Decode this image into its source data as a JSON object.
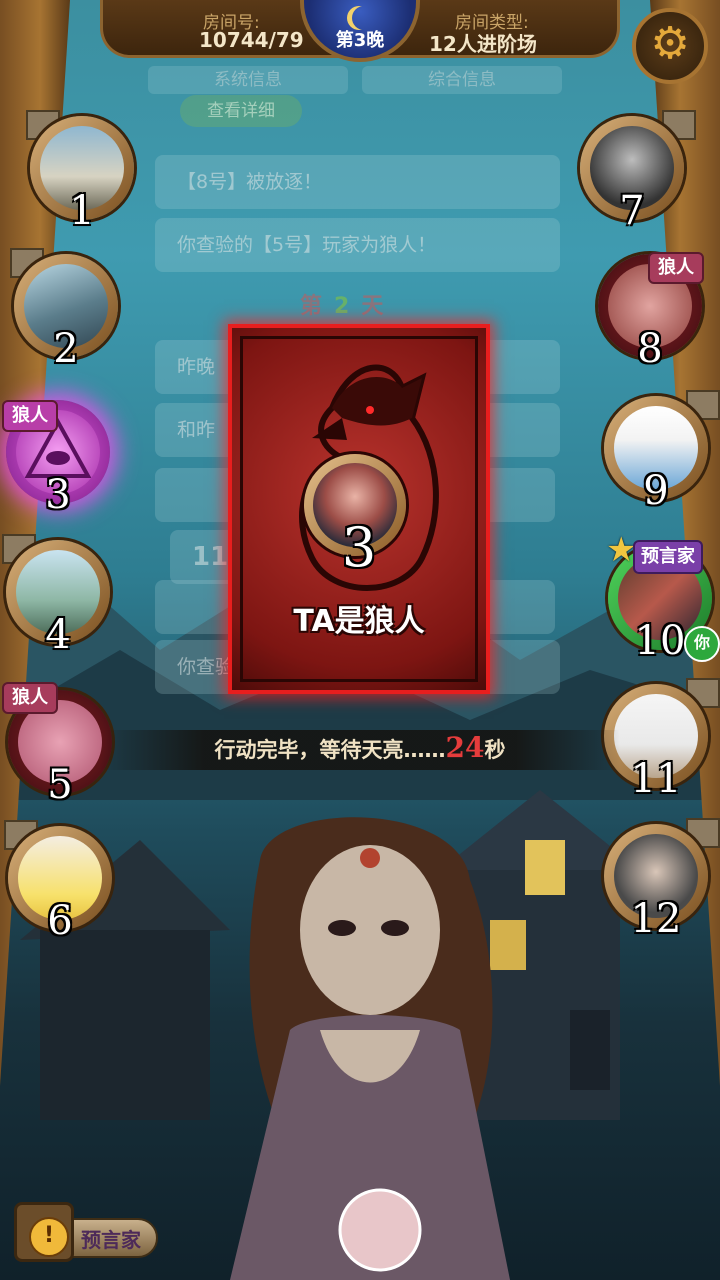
{
  "room": {
    "id_label": "房间号:",
    "id_value": "10744/79",
    "type_label": "房间类型:",
    "type_value": "12人进阶场",
    "night": "第3晚"
  },
  "settings": {
    "icon": "gear-icon"
  },
  "background_log": {
    "tab_left": "系统信息",
    "tab_right": "综合信息",
    "detail_button": "查看详细",
    "msg_exiled": "【8号】被放逐！",
    "msg_check": "你查验的【5号】玩家为狼人！",
    "day_prefix": "第",
    "day_num": "2",
    "day_suffix": "天",
    "msg_last_night": "昨晚",
    "msg_and": "和昨",
    "msg_count": "11",
    "msg_check2": "你查验"
  },
  "players": [
    {
      "num": "1"
    },
    {
      "num": "2"
    },
    {
      "num": "3",
      "tag": "狼人"
    },
    {
      "num": "4"
    },
    {
      "num": "5",
      "tag": "狼人"
    },
    {
      "num": "6"
    },
    {
      "num": "7"
    },
    {
      "num": "8",
      "tag": "狼人"
    },
    {
      "num": "9"
    },
    {
      "num": "10",
      "tag": "预言家",
      "you": "你"
    },
    {
      "num": "11"
    },
    {
      "num": "12"
    }
  ],
  "result_card": {
    "player_num": "3",
    "text": "TA是狼人"
  },
  "status": {
    "text": "行动完毕，等待天亮……",
    "seconds": "24",
    "unit": "秒"
  },
  "role_button": {
    "label": "预言家",
    "icon": "exclamation-icon"
  }
}
